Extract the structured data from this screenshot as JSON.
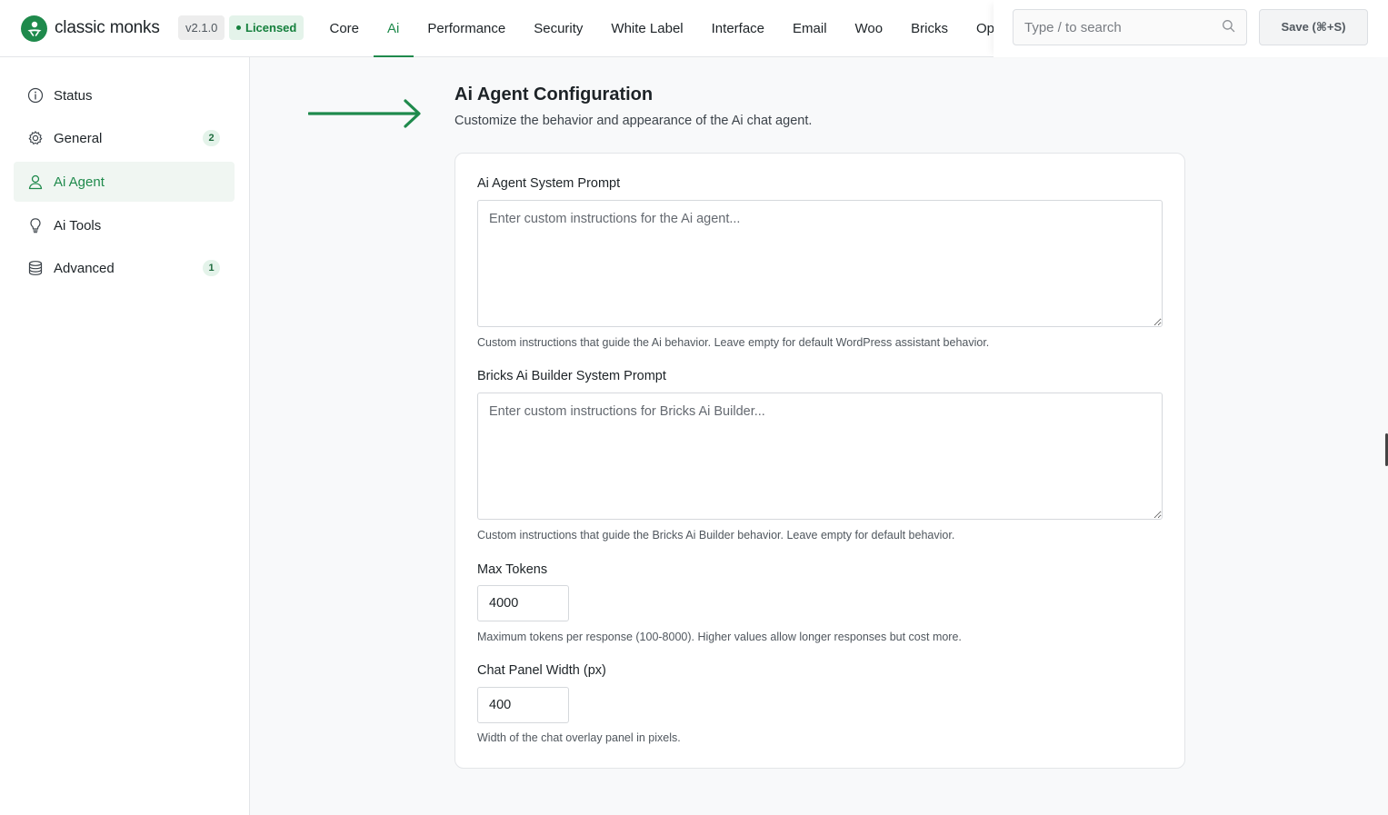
{
  "brand": {
    "name": "classic monks",
    "version": "v2.1.0",
    "license_status": "Licensed"
  },
  "nav": {
    "tabs": [
      "Core",
      "Ai",
      "Performance",
      "Security",
      "White Label",
      "Interface",
      "Email",
      "Woo",
      "Bricks",
      "Opt"
    ],
    "active_tab": "Ai"
  },
  "search": {
    "placeholder": "Type / to search"
  },
  "save": {
    "label": "Save (⌘+S)"
  },
  "sidebar": {
    "items": [
      {
        "label": "Status",
        "icon": "info-icon"
      },
      {
        "label": "General",
        "icon": "gear-icon",
        "badge": "2"
      },
      {
        "label": "Ai Agent",
        "icon": "user-icon"
      },
      {
        "label": "Ai Tools",
        "icon": "lightbulb-icon"
      },
      {
        "label": "Advanced",
        "icon": "database-icon",
        "badge": "1"
      }
    ],
    "active": "Ai Agent"
  },
  "page": {
    "title": "Ai Agent Configuration",
    "subtitle": "Customize the behavior and appearance of the Ai chat agent."
  },
  "form": {
    "system_prompt": {
      "label": "Ai Agent System Prompt",
      "placeholder": "Enter custom instructions for the Ai agent...",
      "value": "",
      "help": "Custom instructions that guide the Ai behavior. Leave empty for default WordPress assistant behavior."
    },
    "bricks_prompt": {
      "label": "Bricks Ai Builder System Prompt",
      "placeholder": "Enter custom instructions for Bricks Ai Builder...",
      "value": "",
      "help": "Custom instructions that guide the Bricks Ai Builder behavior. Leave empty for default behavior."
    },
    "max_tokens": {
      "label": "Max Tokens",
      "value": "4000",
      "help": "Maximum tokens per response (100-8000). Higher values allow longer responses but cost more."
    },
    "panel_width": {
      "label": "Chat Panel Width (px)",
      "value": "400",
      "help": "Width of the chat overlay panel in pixels."
    }
  },
  "colors": {
    "accent": "#1f8a4c",
    "active_bg": "#f0f6f2",
    "badge_bg": "#e4f3ea"
  }
}
